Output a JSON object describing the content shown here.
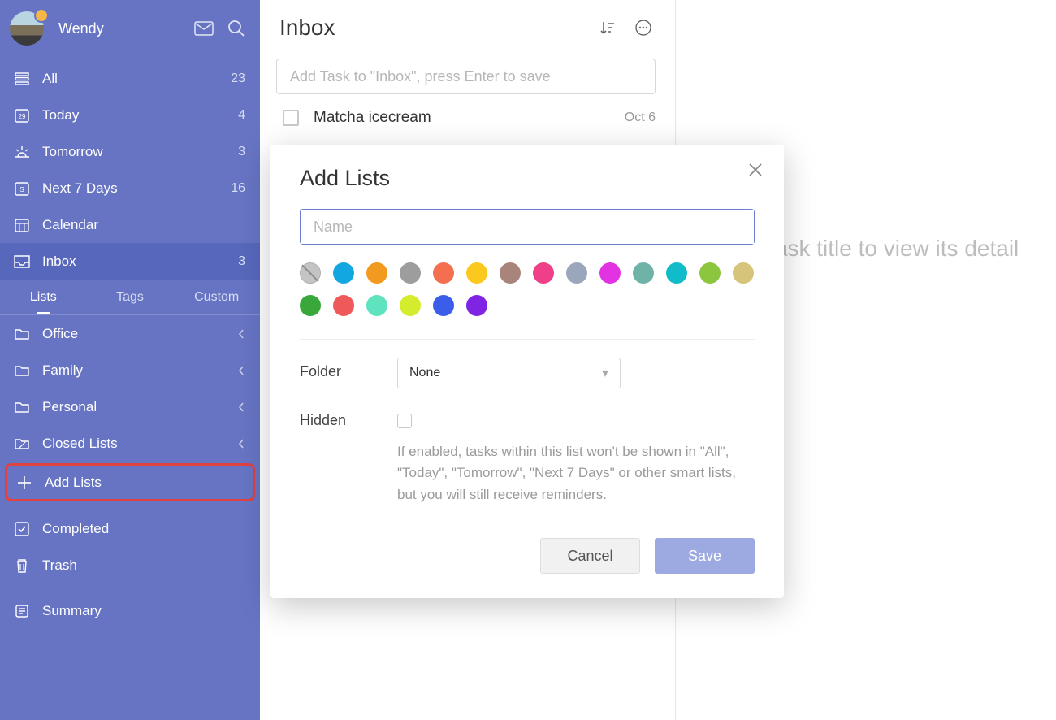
{
  "user": {
    "name": "Wendy"
  },
  "sidebar": {
    "smart_lists": [
      {
        "key": "all",
        "label": "All",
        "count": "23",
        "icon": "stack-icon"
      },
      {
        "key": "today",
        "label": "Today",
        "count": "4",
        "icon": "calendar-29-icon"
      },
      {
        "key": "tomorrow",
        "label": "Tomorrow",
        "count": "3",
        "icon": "sunrise-icon"
      },
      {
        "key": "next7",
        "label": "Next 7 Days",
        "count": "16",
        "icon": "calendar-s-icon"
      },
      {
        "key": "calendar",
        "label": "Calendar",
        "count": "",
        "icon": "calendar-grid-icon"
      },
      {
        "key": "inbox",
        "label": "Inbox",
        "count": "3",
        "icon": "inbox-icon"
      }
    ],
    "tabs": [
      {
        "label": "Lists",
        "active": true
      },
      {
        "label": "Tags",
        "active": false
      },
      {
        "label": "Custom",
        "active": false
      }
    ],
    "lists": [
      {
        "label": "Office"
      },
      {
        "label": "Family"
      },
      {
        "label": "Personal"
      },
      {
        "label": "Closed Lists"
      }
    ],
    "add_lists_label": "Add Lists",
    "footer": {
      "completed": "Completed",
      "trash": "Trash",
      "summary": "Summary"
    }
  },
  "inbox": {
    "title": "Inbox",
    "add_task_placeholder": "Add Task to \"Inbox\", press Enter to save",
    "tasks": [
      {
        "title": "Matcha icecream",
        "date": "Oct 6"
      }
    ]
  },
  "detail": {
    "empty_text": "Click task title to view its detail"
  },
  "modal": {
    "title": "Add Lists",
    "name_placeholder": "Name",
    "swatches": [
      "none",
      "#13a7e2",
      "#f29a1f",
      "#9d9d9d",
      "#f36f4f",
      "#fbc81e",
      "#a8847b",
      "#ef3f89",
      "#9aa6bb",
      "#e233e2",
      "#6fb2a8",
      "#10bcc9",
      "#8cc63f",
      "#d6c47b",
      "#39a83b",
      "#ef5959",
      "#5fe2be",
      "#d5ec2e",
      "#3a5eea",
      "#7e24e2"
    ],
    "folder_label": "Folder",
    "folder_value": "None",
    "hidden_label": "Hidden",
    "hidden_desc": "If enabled, tasks within this list won't be shown in \"All\", \"Today\", \"Tomorrow\", \"Next 7 Days\" or other smart lists, but you will still receive reminders.",
    "cancel": "Cancel",
    "save": "Save"
  }
}
